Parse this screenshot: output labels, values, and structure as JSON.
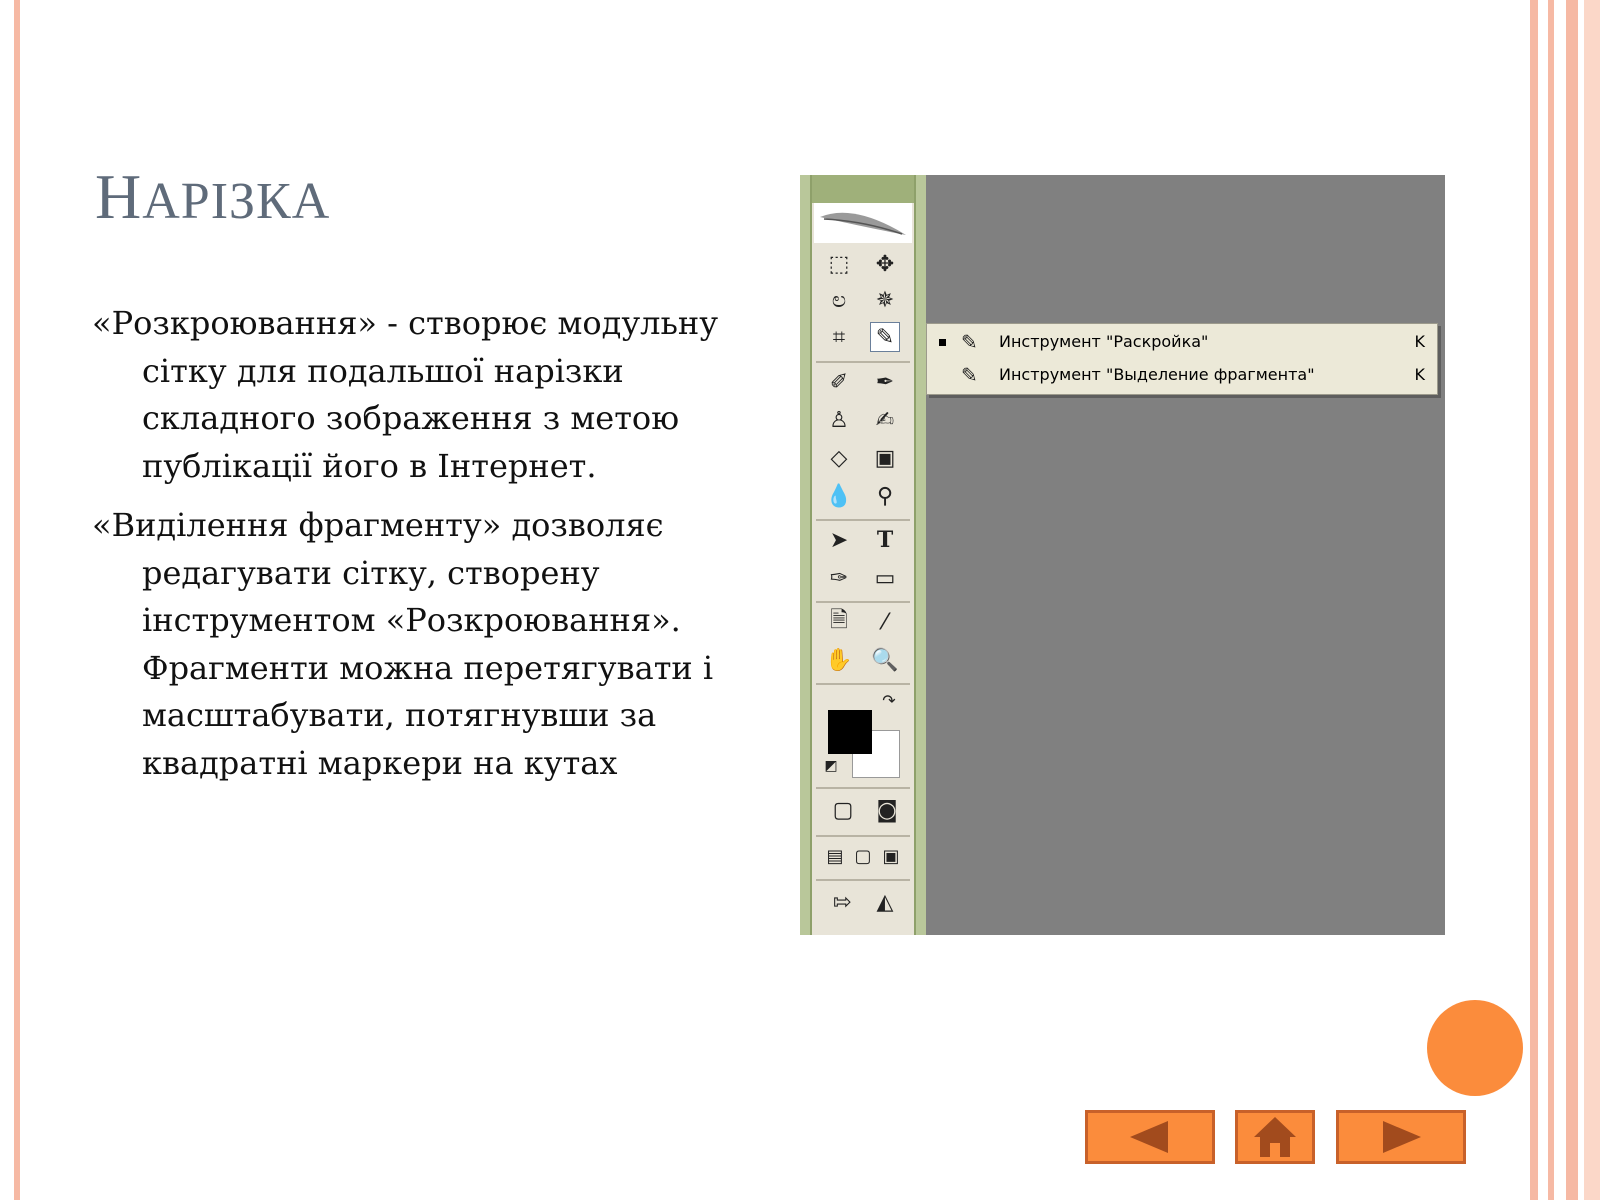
{
  "slide": {
    "title_first": "Н",
    "title_rest": "АРІЗКА",
    "paragraphs": [
      "«Розкроювання» - створює модульну сітку для подальшої нарізки складного зображення з метою публікації його в Інтернет.",
      "«Виділення фрагменту» дозволяє редагувати сітку, створену інструментом «Розкроювання». Фрагменти можна перетягувати і масштабувати, потягнувши за квадратні маркери на кутах"
    ]
  },
  "flyout_menu": {
    "items": [
      {
        "label": "Инструмент \"Раскройка\"",
        "shortcut": "K",
        "selected": true,
        "icon": "slice-icon"
      },
      {
        "label": "Инструмент \"Выделение фрагмента\"",
        "shortcut": "K",
        "selected": false,
        "icon": "slice-select-icon"
      }
    ]
  },
  "navigation": {
    "buttons": [
      {
        "icon": "arrow-left-icon"
      },
      {
        "icon": "home-icon"
      },
      {
        "icon": "arrow-right-icon"
      }
    ]
  },
  "colors": {
    "accent_orange": "#fb8c3c",
    "frame_pink": "#f6b9a4",
    "title_gray": "#5f6b7a",
    "canvas_gray": "#808080"
  }
}
